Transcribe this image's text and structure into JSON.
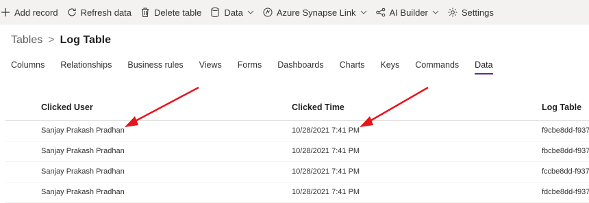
{
  "command_bar": {
    "add_record": "Add record",
    "refresh_data": "Refresh data",
    "delete_table": "Delete table",
    "data": "Data",
    "azure_synapse_link": "Azure Synapse Link",
    "ai_builder": "AI Builder",
    "settings": "Settings"
  },
  "breadcrumb": {
    "parent": "Tables",
    "separator": ">",
    "current": "Log Table"
  },
  "tabs": [
    "Columns",
    "Relationships",
    "Business rules",
    "Views",
    "Forms",
    "Dashboards",
    "Charts",
    "Keys",
    "Commands",
    "Data"
  ],
  "active_tab": "Data",
  "grid": {
    "columns": [
      "Clicked User",
      "Clicked Time",
      "Log Table"
    ],
    "rows": [
      [
        "Sanjay Prakash Pradhan",
        "10/28/2021 7:41 PM",
        "f9cbe8dd-f937"
      ],
      [
        "Sanjay Prakash Pradhan",
        "10/28/2021 7:41 PM",
        "fbcbe8dd-f937"
      ],
      [
        "Sanjay Prakash Pradhan",
        "10/28/2021 7:41 PM",
        "fccbe8dd-f937-"
      ],
      [
        "Sanjay Prakash Pradhan",
        "10/28/2021 7:41 PM",
        "fdcbe8dd-f937"
      ]
    ]
  },
  "colors": {
    "annotation_arrow": "#e8141b",
    "active_tab_underline": "#5c2d91",
    "command_bar_bg": "#f3f2f1"
  }
}
